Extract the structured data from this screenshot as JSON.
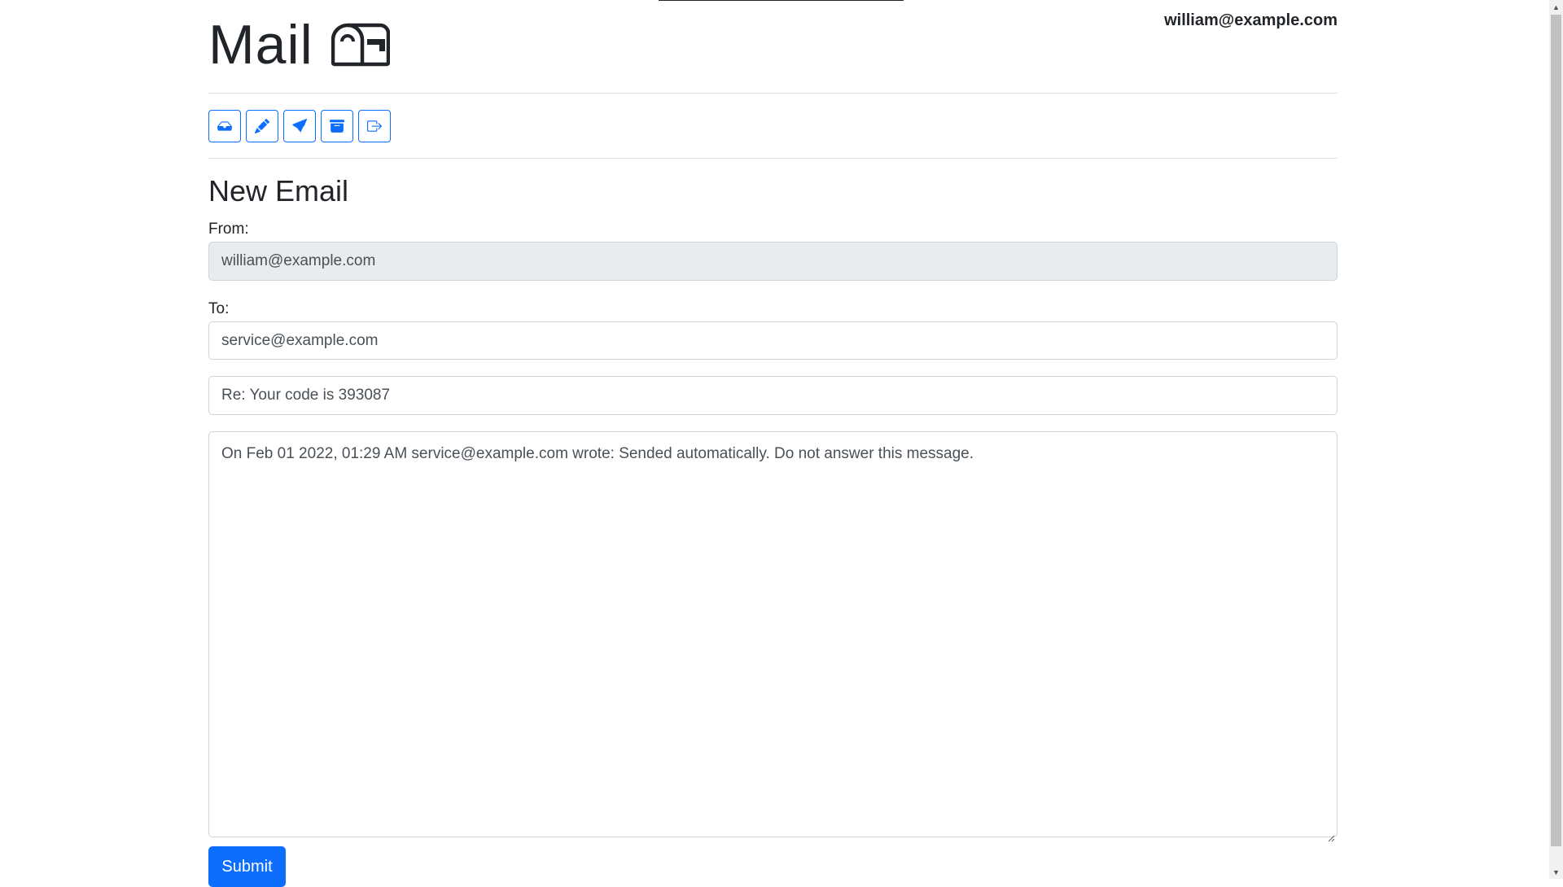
{
  "header": {
    "app_title": "Mail",
    "user_email": "william@example.com"
  },
  "toolbar": {
    "buttons": [
      {
        "name": "inbox",
        "icon": "inbox-icon"
      },
      {
        "name": "compose",
        "icon": "pencil-icon"
      },
      {
        "name": "sent",
        "icon": "send-icon"
      },
      {
        "name": "archive",
        "icon": "archive-icon"
      },
      {
        "name": "logout",
        "icon": "box-arrow-right-icon"
      }
    ]
  },
  "form": {
    "heading": "New Email",
    "from_label": "From:",
    "from_value": "william@example.com",
    "to_label": "To:",
    "to_value": "service@example.com",
    "subject_value": "Re: Your code is 393087",
    "body_value": "On Feb 01 2022, 01:29 AM service@example.com wrote: Sended automatically. Do not answer this message.",
    "submit_label": "Submit"
  },
  "colors": {
    "primary": "#0d6efd",
    "disabled_bg": "#e9ecef",
    "border": "#ced4da"
  }
}
